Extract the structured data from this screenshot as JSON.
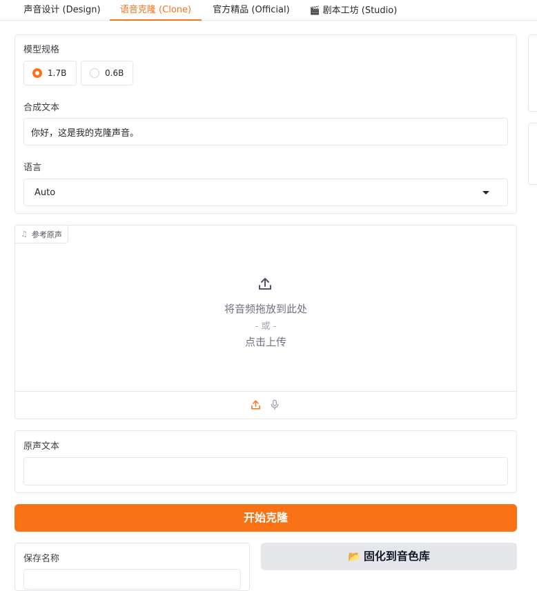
{
  "tabs": [
    {
      "label": "声音设计 (Design)",
      "icon": ""
    },
    {
      "label": "语音克隆 (Clone)",
      "icon": "",
      "active": true
    },
    {
      "label": "官方精品 (Official)",
      "icon": ""
    },
    {
      "label": "剧本工坊 (Studio)",
      "icon": "clapperboard-icon"
    }
  ],
  "clapper_glyph": "🎬",
  "model": {
    "label": "模型规格",
    "options": [
      "1.7B",
      "0.6B"
    ],
    "selected": "1.7B"
  },
  "synth_text": {
    "label": "合成文本",
    "value": "你好，这是我的克隆声音。"
  },
  "language": {
    "label": "语言",
    "value": "Auto"
  },
  "reference_audio": {
    "label": "参考原声",
    "drop_text": "将音频拖放到此处",
    "or_text": "- 或 -",
    "click_text": "点击上传"
  },
  "source_text": {
    "label": "原声文本",
    "value": ""
  },
  "start_button": "开始克隆",
  "save_name": {
    "label": "保存名称"
  },
  "save_button": {
    "icon_glyph": "📂",
    "label": "固化到音色库"
  },
  "colors": {
    "accent": "#f97316",
    "border": "#e5e7eb",
    "secondary_button": "#e5e7eb"
  }
}
